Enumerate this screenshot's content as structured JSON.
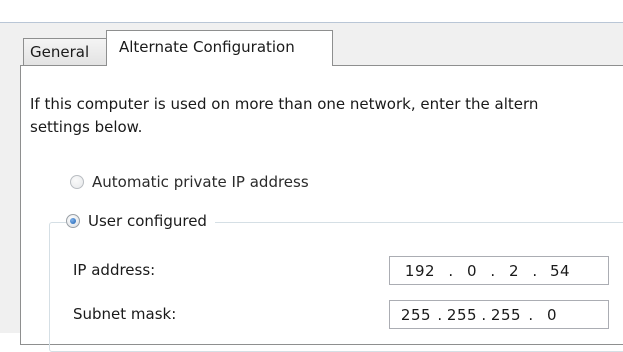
{
  "tabs": [
    {
      "label": "General"
    },
    {
      "label": "Alternate Configuration"
    }
  ],
  "intro_lines": [
    "If this computer is used on more than one network, enter the altern",
    "settings below."
  ],
  "options": {
    "automatic": {
      "label": "Automatic private IP address",
      "selected": false
    },
    "user": {
      "label": "User configured",
      "selected": true
    }
  },
  "fields": {
    "ip": {
      "label": "IP address:",
      "octets": [
        "192",
        "0",
        "2",
        "54"
      ]
    },
    "subnet": {
      "label": "Subnet mask:",
      "octets": [
        "255",
        "255",
        "255",
        "0"
      ]
    }
  }
}
